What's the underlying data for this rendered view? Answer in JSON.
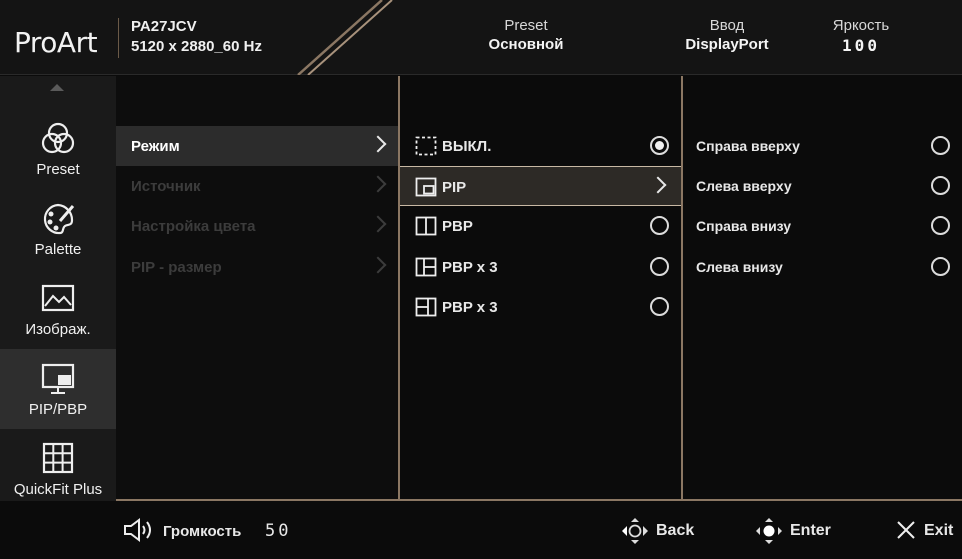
{
  "header": {
    "logo": "ProArt",
    "model": "PA27JCV",
    "resolution": "5120 x 2880_60 Hz",
    "preset_label": "Preset",
    "preset_value": "Основной",
    "input_label": "Ввод",
    "input_value": "DisplayPort",
    "brightness_label": "Яркость",
    "brightness_value": "100"
  },
  "sidebar": {
    "items": [
      {
        "label": "Preset",
        "icon": "preset-icon"
      },
      {
        "label": "Palette",
        "icon": "palette-icon"
      },
      {
        "label": "Изображ.",
        "icon": "image-icon"
      },
      {
        "label": "PIP/PBP",
        "icon": "pip-pbp-icon",
        "active": true
      },
      {
        "label": "QuickFit Plus",
        "icon": "grid-icon"
      }
    ]
  },
  "menu1": {
    "items": [
      {
        "label": "Режим",
        "selected": true
      },
      {
        "label": "Источник"
      },
      {
        "label": "Настройка цвета"
      },
      {
        "label": "PIP - размер"
      }
    ]
  },
  "menu2": {
    "items": [
      {
        "label": "ВЫКЛ.",
        "icon": "off-dashed-icon",
        "radio": "on"
      },
      {
        "label": "PIP",
        "icon": "pip-icon",
        "selected": true
      },
      {
        "label": "PBP",
        "icon": "pbp-icon",
        "radio": "off"
      },
      {
        "label": "PBP x 3",
        "icon": "pbp-3-left-icon",
        "radio": "off"
      },
      {
        "label": "PBP x 3",
        "icon": "pbp-3-right-icon",
        "radio": "off"
      }
    ]
  },
  "menu3": {
    "items": [
      {
        "label": "Справа вверху"
      },
      {
        "label": "Слева вверху"
      },
      {
        "label": "Справа внизу"
      },
      {
        "label": "Слева внизу"
      }
    ]
  },
  "footer": {
    "volume_label": "Громкость",
    "volume_value": "50",
    "back_label": "Back",
    "enter_label": "Enter",
    "exit_label": "Exit"
  },
  "colors": {
    "accent_line": "#8b7763",
    "selected_row": "#2d2a26",
    "sidebar_active": "#2e2e2e"
  }
}
